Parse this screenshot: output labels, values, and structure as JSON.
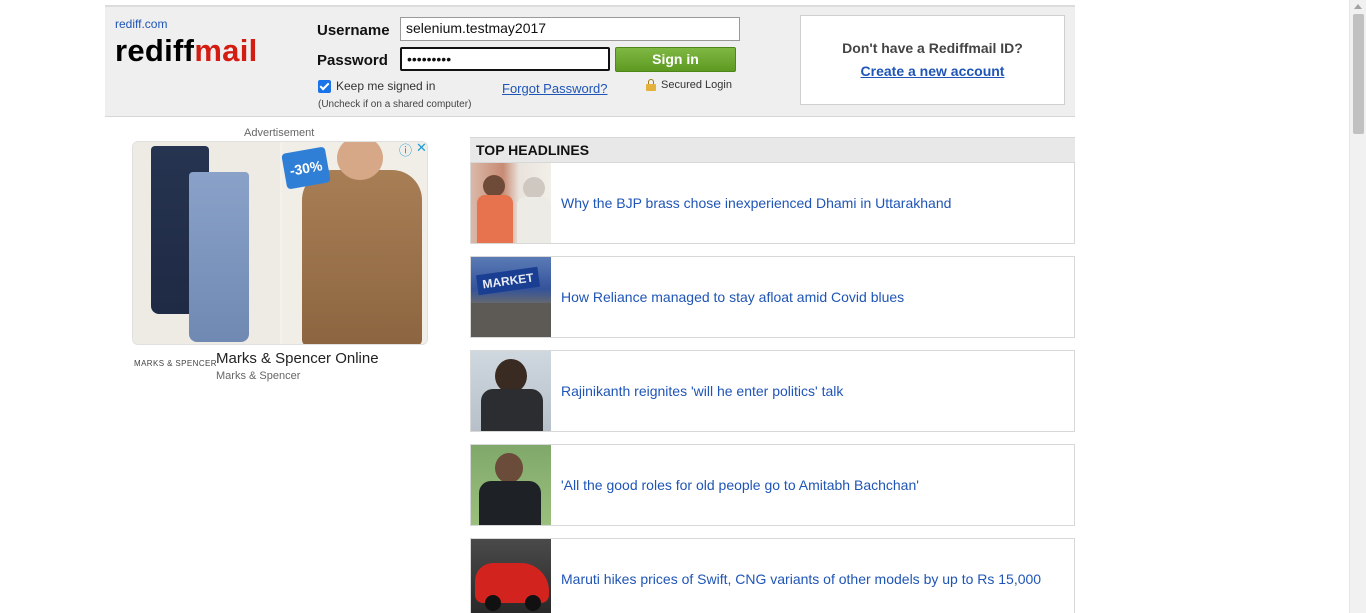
{
  "header": {
    "site_link": "rediff.com",
    "logo_part1": "rediff",
    "logo_part2": "mail",
    "username_label": "Username",
    "username_value": "selenium.testmay2017",
    "password_label": "Password",
    "password_value": "•••••••••",
    "signin_label": "Sign in",
    "keep_signed_in": "Keep me signed in",
    "keep_checked": true,
    "uncheck_hint": "(Uncheck if on a shared computer)",
    "forgot_password": "Forgot Password?",
    "secured_login": "Secured Login",
    "no_account_question": "Don't have a Rediffmail ID?",
    "create_account": "Create a new account"
  },
  "ad": {
    "label": "Advertisement",
    "discount_badge": "-30%",
    "info_icon": "ⓘ",
    "close_icon": "✕",
    "brand_logo": "MARKS & SPENCER",
    "title": "Marks & Spencer Online",
    "subtitle": "Marks & Spencer"
  },
  "headlines": {
    "title": "TOP HEADLINES",
    "market_sign": "MARKET",
    "items": [
      {
        "text": "Why the BJP brass chose inexperienced Dhami in Uttarakhand"
      },
      {
        "text": "How Reliance managed to stay afloat amid Covid blues"
      },
      {
        "text": "Rajinikanth reignites 'will he enter politics' talk"
      },
      {
        "text": "'All the good roles for old people go to Amitabh Bachchan'"
      },
      {
        "text": "Maruti hikes prices of Swift, CNG variants of other models by up to Rs 15,000"
      }
    ]
  },
  "colors": {
    "link_blue": "#1f55b6",
    "logo_red": "#d31d12",
    "signin_green": "#6aa82e"
  }
}
